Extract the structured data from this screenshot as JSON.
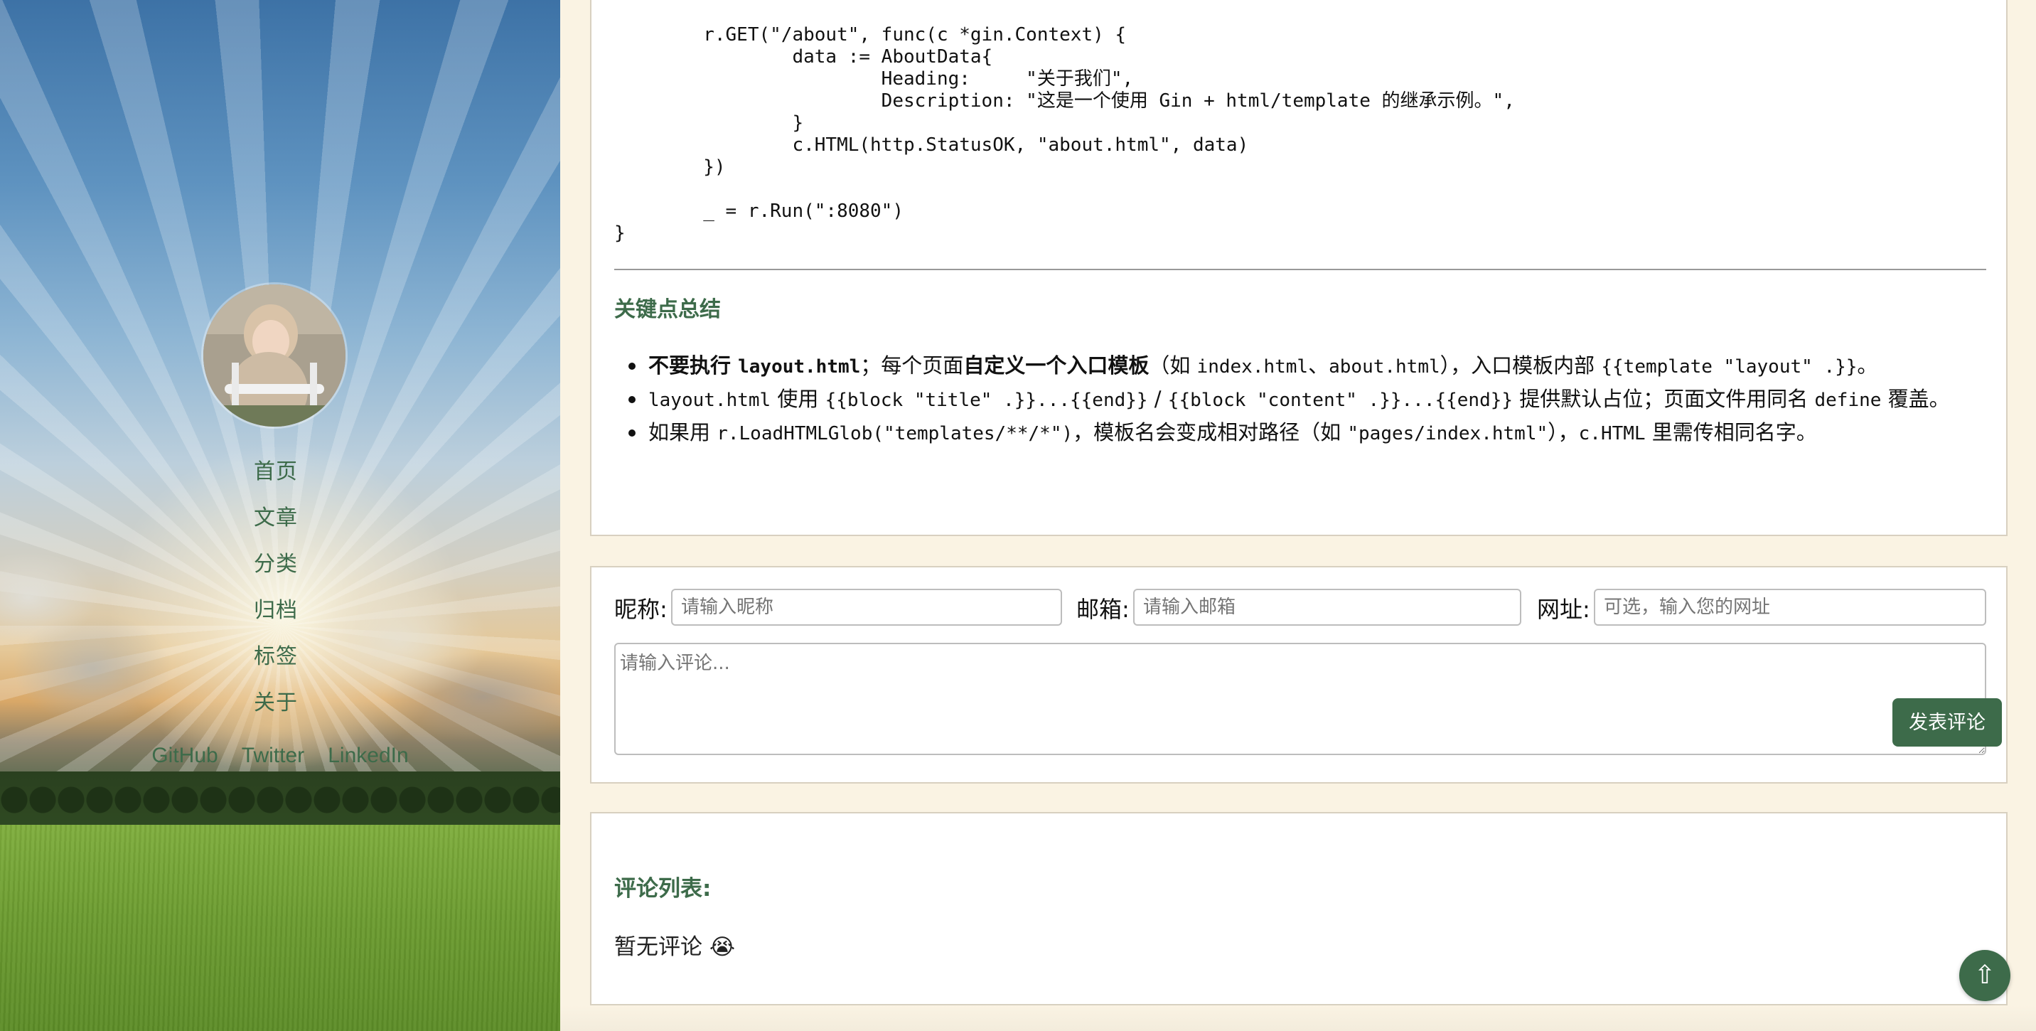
{
  "sidebar": {
    "nav": [
      "首页",
      "文章",
      "分类",
      "归档",
      "标签",
      "关于"
    ],
    "social": [
      "GitHub",
      "Twitter",
      "LinkedIn"
    ]
  },
  "article": {
    "code_lines": [
      "        })",
      "",
      "        r.GET(\"/about\", func(c *gin.Context) {",
      "                data := AboutData{",
      "                        Heading:     \"关于我们\",",
      "                        Description: \"这是一个使用 Gin + html/template 的继承示例。\",",
      "                }",
      "                c.HTML(http.StatusOK, \"about.html\", data)",
      "        })",
      "",
      "        _ = r.Run(\":8080\")",
      "}"
    ],
    "summary_heading": "关键点总结",
    "bullet1": {
      "b1": "不要执行 ",
      "m1": "layout.html",
      "t1": "；每个页面",
      "b2": "自定义一个入口模板",
      "t2": "（如 ",
      "m2": "index.html",
      "t3": "、",
      "m3": "about.html",
      "t4": "），入口模板内部 ",
      "m4": "{{template \"layout\" .}}",
      "t5": "。"
    },
    "bullet2": {
      "m1": "layout.html",
      "t1": " 使用 ",
      "m2": "{{block \"title\" .}}...{{end}}",
      "t2": " / ",
      "m3": "{{block \"content\" .}}...{{end}}",
      "t3": " 提供默认占位；页面文件用同名 ",
      "m4": "define",
      "t4": " 覆盖。"
    },
    "bullet3": {
      "t1": "如果用 ",
      "m1": "r.LoadHTMLGlob(\"templates/**/*\")",
      "t2": "，模板名会变成相对路径（如 ",
      "m2": "\"pages/index.html\"",
      "t3": "），",
      "m3": "c.HTML",
      "t4": " 里需传相同名字。"
    }
  },
  "comment_form": {
    "nickname_label": "昵称:",
    "nickname_placeholder": "请输入昵称",
    "email_label": "邮箱:",
    "email_placeholder": "请输入邮箱",
    "website_label": "网址:",
    "website_placeholder": "可选，输入您的网址",
    "comment_placeholder": "请输入评论...",
    "submit_label": "发表评论"
  },
  "comments": {
    "heading": "评论列表:",
    "empty_text": "暂无评论 😭"
  },
  "back_to_top": "⇧",
  "colors": {
    "accent": "#3d6b4a",
    "page_bg": "#faf3e3"
  }
}
